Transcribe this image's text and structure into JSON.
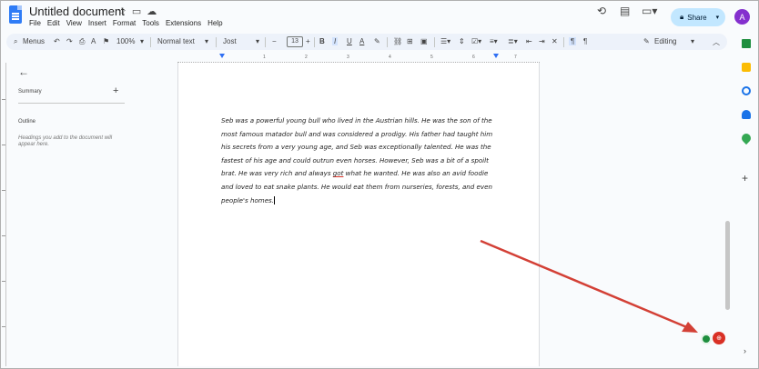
{
  "window": {
    "title": "Untitled document",
    "menu": [
      "File",
      "Edit",
      "View",
      "Insert",
      "Format",
      "Tools",
      "Extensions",
      "Help"
    ],
    "share_label": "Share",
    "avatar_letter": "A"
  },
  "toolbar": {
    "menus_label": "Menus",
    "zoom": "100%",
    "style": "Normal text",
    "font": "Jost",
    "font_size": "13",
    "mode": "Editing"
  },
  "ruler": {
    "ticks": [
      "1",
      "2",
      "3",
      "4",
      "5",
      "6",
      "7"
    ]
  },
  "sidebar": {
    "summary_label": "Summary",
    "outline_label": "Outline",
    "outline_hint": "Headings you add to the document will appear here."
  },
  "document": {
    "text_before": "Seb was a powerful young bull who lived in the Austrian hills. He was the son of the most famous matador bull and was considered a prodigy. His father had taught him his secrets from a very young age, and Seb was exceptionally talented. He was the fastest of his age and could outrun even horses. However, Seb was a bit of a spoilt brat. He was very rich and always ",
    "misspelled": "got",
    "text_after": " what he wanted. He was also an avid foodie and loved to eat snake plants. He would eat them from nurseries, forests, and even people's homes."
  },
  "colors": {
    "accent": "#2f7cf6",
    "share_bg": "#c2e7ff",
    "arrow": "#d34036",
    "avatar": "#8430ce"
  },
  "icons": [
    "doc-logo-icon",
    "star-icon",
    "folder-icon",
    "cloud-icon",
    "history-icon",
    "comment-icon",
    "meet-icon",
    "lock-icon",
    "search-icon",
    "undo-icon",
    "redo-icon",
    "print-icon",
    "spellcheck-icon",
    "paint-format-icon",
    "pencil-icon",
    "back-arrow-icon",
    "plus-icon"
  ]
}
